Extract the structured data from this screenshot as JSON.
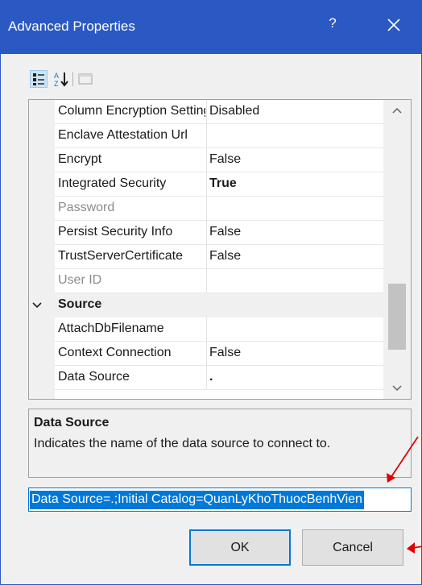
{
  "window": {
    "title": "Advanced Properties",
    "help_glyph": "?",
    "accent": "#2b59c3"
  },
  "toolbar": {
    "buttons": [
      "categorized-icon",
      "alphabetical-icon",
      "property-pages-icon"
    ]
  },
  "properties": {
    "rows": [
      {
        "name": "Column Encryption Setting",
        "value": "Disabled"
      },
      {
        "name": "Enclave Attestation Url",
        "value": ""
      },
      {
        "name": "Encrypt",
        "value": "False"
      },
      {
        "name": "Integrated Security",
        "value": "True"
      },
      {
        "name": "Password",
        "value": ""
      },
      {
        "name": "Persist Security Info",
        "value": "False"
      },
      {
        "name": "TrustServerCertificate",
        "value": "False"
      },
      {
        "name": "User ID",
        "value": ""
      }
    ],
    "category": "Source",
    "source_rows": [
      {
        "name": "AttachDbFilename",
        "value": ""
      },
      {
        "name": "Context Connection",
        "value": "False"
      },
      {
        "name": "Data Source",
        "value": "."
      }
    ]
  },
  "description": {
    "title": "Data Source",
    "text": "Indicates the name of the data source to connect to."
  },
  "connection_string": "Data Source=.;Initial Catalog=QuanLyKhoThuocBenhVien",
  "buttons": {
    "ok": "OK",
    "cancel": "Cancel"
  },
  "colors": {
    "selection": "#0078d7",
    "annotation_arrow": "#e00000"
  }
}
